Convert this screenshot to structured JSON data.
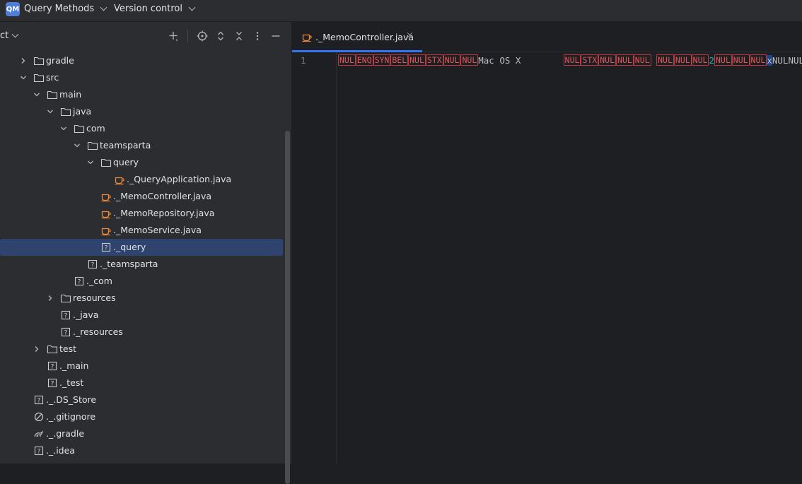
{
  "topbar": {
    "project_badge": "QM",
    "project_name": "Query Methods",
    "vcs_label": "Version control"
  },
  "panel": {
    "title": "ct"
  },
  "tree": [
    {
      "label": "gradle",
      "type": "folder",
      "arrow": "right"
    },
    {
      "label": "src",
      "type": "folder",
      "arrow": "down"
    },
    {
      "label": "main",
      "type": "folder",
      "arrow": "down"
    },
    {
      "label": "java",
      "type": "folder",
      "arrow": "down"
    },
    {
      "label": "com",
      "type": "folder",
      "arrow": "down"
    },
    {
      "label": "teamsparta",
      "type": "folder",
      "arrow": "down"
    },
    {
      "label": "query",
      "type": "folder",
      "arrow": "down"
    },
    {
      "label": "._QueryApplication.java",
      "type": "java"
    },
    {
      "label": "._MemoController.java",
      "type": "java"
    },
    {
      "label": "._MemoRepository.java",
      "type": "java"
    },
    {
      "label": "._MemoService.java",
      "type": "java"
    },
    {
      "label": "._query",
      "type": "unknown",
      "selected": true
    },
    {
      "label": "._teamsparta",
      "type": "unknown"
    },
    {
      "label": "._com",
      "type": "unknown"
    },
    {
      "label": "resources",
      "type": "folder",
      "arrow": "right"
    },
    {
      "label": "._java",
      "type": "unknown"
    },
    {
      "label": "._resources",
      "type": "unknown"
    },
    {
      "label": "test",
      "type": "folder",
      "arrow": "right"
    },
    {
      "label": "._main",
      "type": "unknown"
    },
    {
      "label": "._test",
      "type": "unknown"
    },
    {
      "label": "._.DS_Store",
      "type": "unknown"
    },
    {
      "label": "._.gitignore",
      "type": "ignored"
    },
    {
      "label": "._.gradle",
      "type": "gradle"
    },
    {
      "label": "._.idea",
      "type": "unknown"
    }
  ],
  "editor": {
    "tab_label": "._MemoController.java",
    "line_number": "1",
    "code_tokens": [
      {
        "t": "NUL",
        "k": "ctl"
      },
      {
        "t": "ENQ",
        "k": "ctl"
      },
      {
        "t": "SYN",
        "k": "ctl"
      },
      {
        "t": "BEL",
        "k": "ctl"
      },
      {
        "t": "NUL",
        "k": "ctl"
      },
      {
        "t": "STX",
        "k": "ctl"
      },
      {
        "t": "NUL",
        "k": "ctl"
      },
      {
        "t": "NUL",
        "k": "ctl"
      },
      {
        "t": "Mac OS X        ",
        "k": "plain"
      },
      {
        "t": "NUL",
        "k": "ctl"
      },
      {
        "t": "STX",
        "k": "ctl"
      },
      {
        "t": "NUL",
        "k": "ctl"
      },
      {
        "t": "NUL",
        "k": "ctl"
      },
      {
        "t": "NUL",
        "k": "ctl"
      },
      {
        "t": " ",
        "k": "plain"
      },
      {
        "t": "NUL",
        "k": "ctl"
      },
      {
        "t": "NUL",
        "k": "ctl"
      },
      {
        "t": "NUL",
        "k": "ctl"
      },
      {
        "t": "2",
        "k": "num"
      },
      {
        "t": "NUL",
        "k": "ctl"
      },
      {
        "t": "NUL",
        "k": "ctl"
      },
      {
        "t": "NUL",
        "k": "ctl"
      },
      {
        "t": "x",
        "k": "caret"
      },
      {
        "t": "NUL",
        "k": "plain"
      },
      {
        "t": "NUL",
        "k": "plain"
      }
    ]
  },
  "colors": {
    "accent": "#3574f0",
    "selection": "#2e436e",
    "java_icon": "#e8883a",
    "control_char": "#e5545a"
  }
}
